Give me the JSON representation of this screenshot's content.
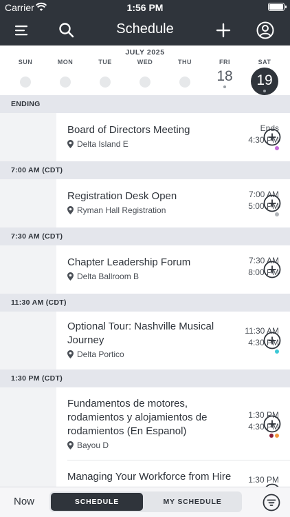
{
  "status_bar": {
    "carrier": "Carrier",
    "time": "1:56 PM"
  },
  "nav": {
    "title": "Schedule",
    "icons": [
      "menu-icon",
      "search-icon",
      "plus-icon",
      "account-icon"
    ]
  },
  "calendar": {
    "month": "JULY 2025",
    "days": [
      {
        "dow": "SUN",
        "date": ""
      },
      {
        "dow": "MON",
        "date": ""
      },
      {
        "dow": "TUE",
        "date": ""
      },
      {
        "dow": "WED",
        "date": ""
      },
      {
        "dow": "THU",
        "date": ""
      },
      {
        "dow": "FRI",
        "date": "18"
      },
      {
        "dow": "SAT",
        "date": "19"
      }
    ],
    "selected": "19"
  },
  "sections": [
    {
      "header": "ENDING",
      "events": [
        {
          "time_start": "Ends",
          "time_end": "4:30 PM",
          "title": "Board of Directors Meeting",
          "location": "Delta Island E",
          "dots": [
            "#c36ad8"
          ]
        }
      ]
    },
    {
      "header": "7:00 AM (CDT)",
      "events": [
        {
          "time_start": "7:00 AM",
          "time_end": "5:00 PM",
          "title": "Registration Desk Open",
          "location": "Ryman Hall Registration",
          "dots": [
            "#b0b4b9"
          ]
        }
      ]
    },
    {
      "header": "7:30 AM (CDT)",
      "events": [
        {
          "time_start": "7:30 AM",
          "time_end": "8:00 PM",
          "title": "Chapter Leadership Forum",
          "location": "Delta Ballroom B",
          "dots": []
        }
      ]
    },
    {
      "header": "11:30 AM (CDT)",
      "events": [
        {
          "time_start": "11:30 AM",
          "time_end": "4:30 PM",
          "title": "Optional Tour: Nashville Musical Journey",
          "location": "Delta Portico",
          "dots": [
            "#3cc8d6"
          ]
        }
      ]
    },
    {
      "header": "1:30 PM (CDT)",
      "events": [
        {
          "time_start": "1:30 PM",
          "time_end": "4:30 PM",
          "title": "Fundamentos de motores, rodamientos y alojamientos de rodamientos (En Espanol)",
          "location": "Bayou D",
          "dots": [
            "#8b1d3a",
            "#f0963c"
          ]
        },
        {
          "time_start": "1:30 PM",
          "time_end": "",
          "title": "Managing Your Workforce from Hire",
          "location": "",
          "dots": []
        }
      ]
    }
  ],
  "bottom_bar": {
    "now_label": "Now",
    "tab_schedule": "SCHEDULE",
    "tab_my_schedule": "MY SCHEDULE",
    "active_tab": "SCHEDULE"
  },
  "colors": {
    "primary_dark": "#2f343b",
    "section_bg": "#e4e6ec",
    "time_col_bg": "#f2f3f5"
  }
}
